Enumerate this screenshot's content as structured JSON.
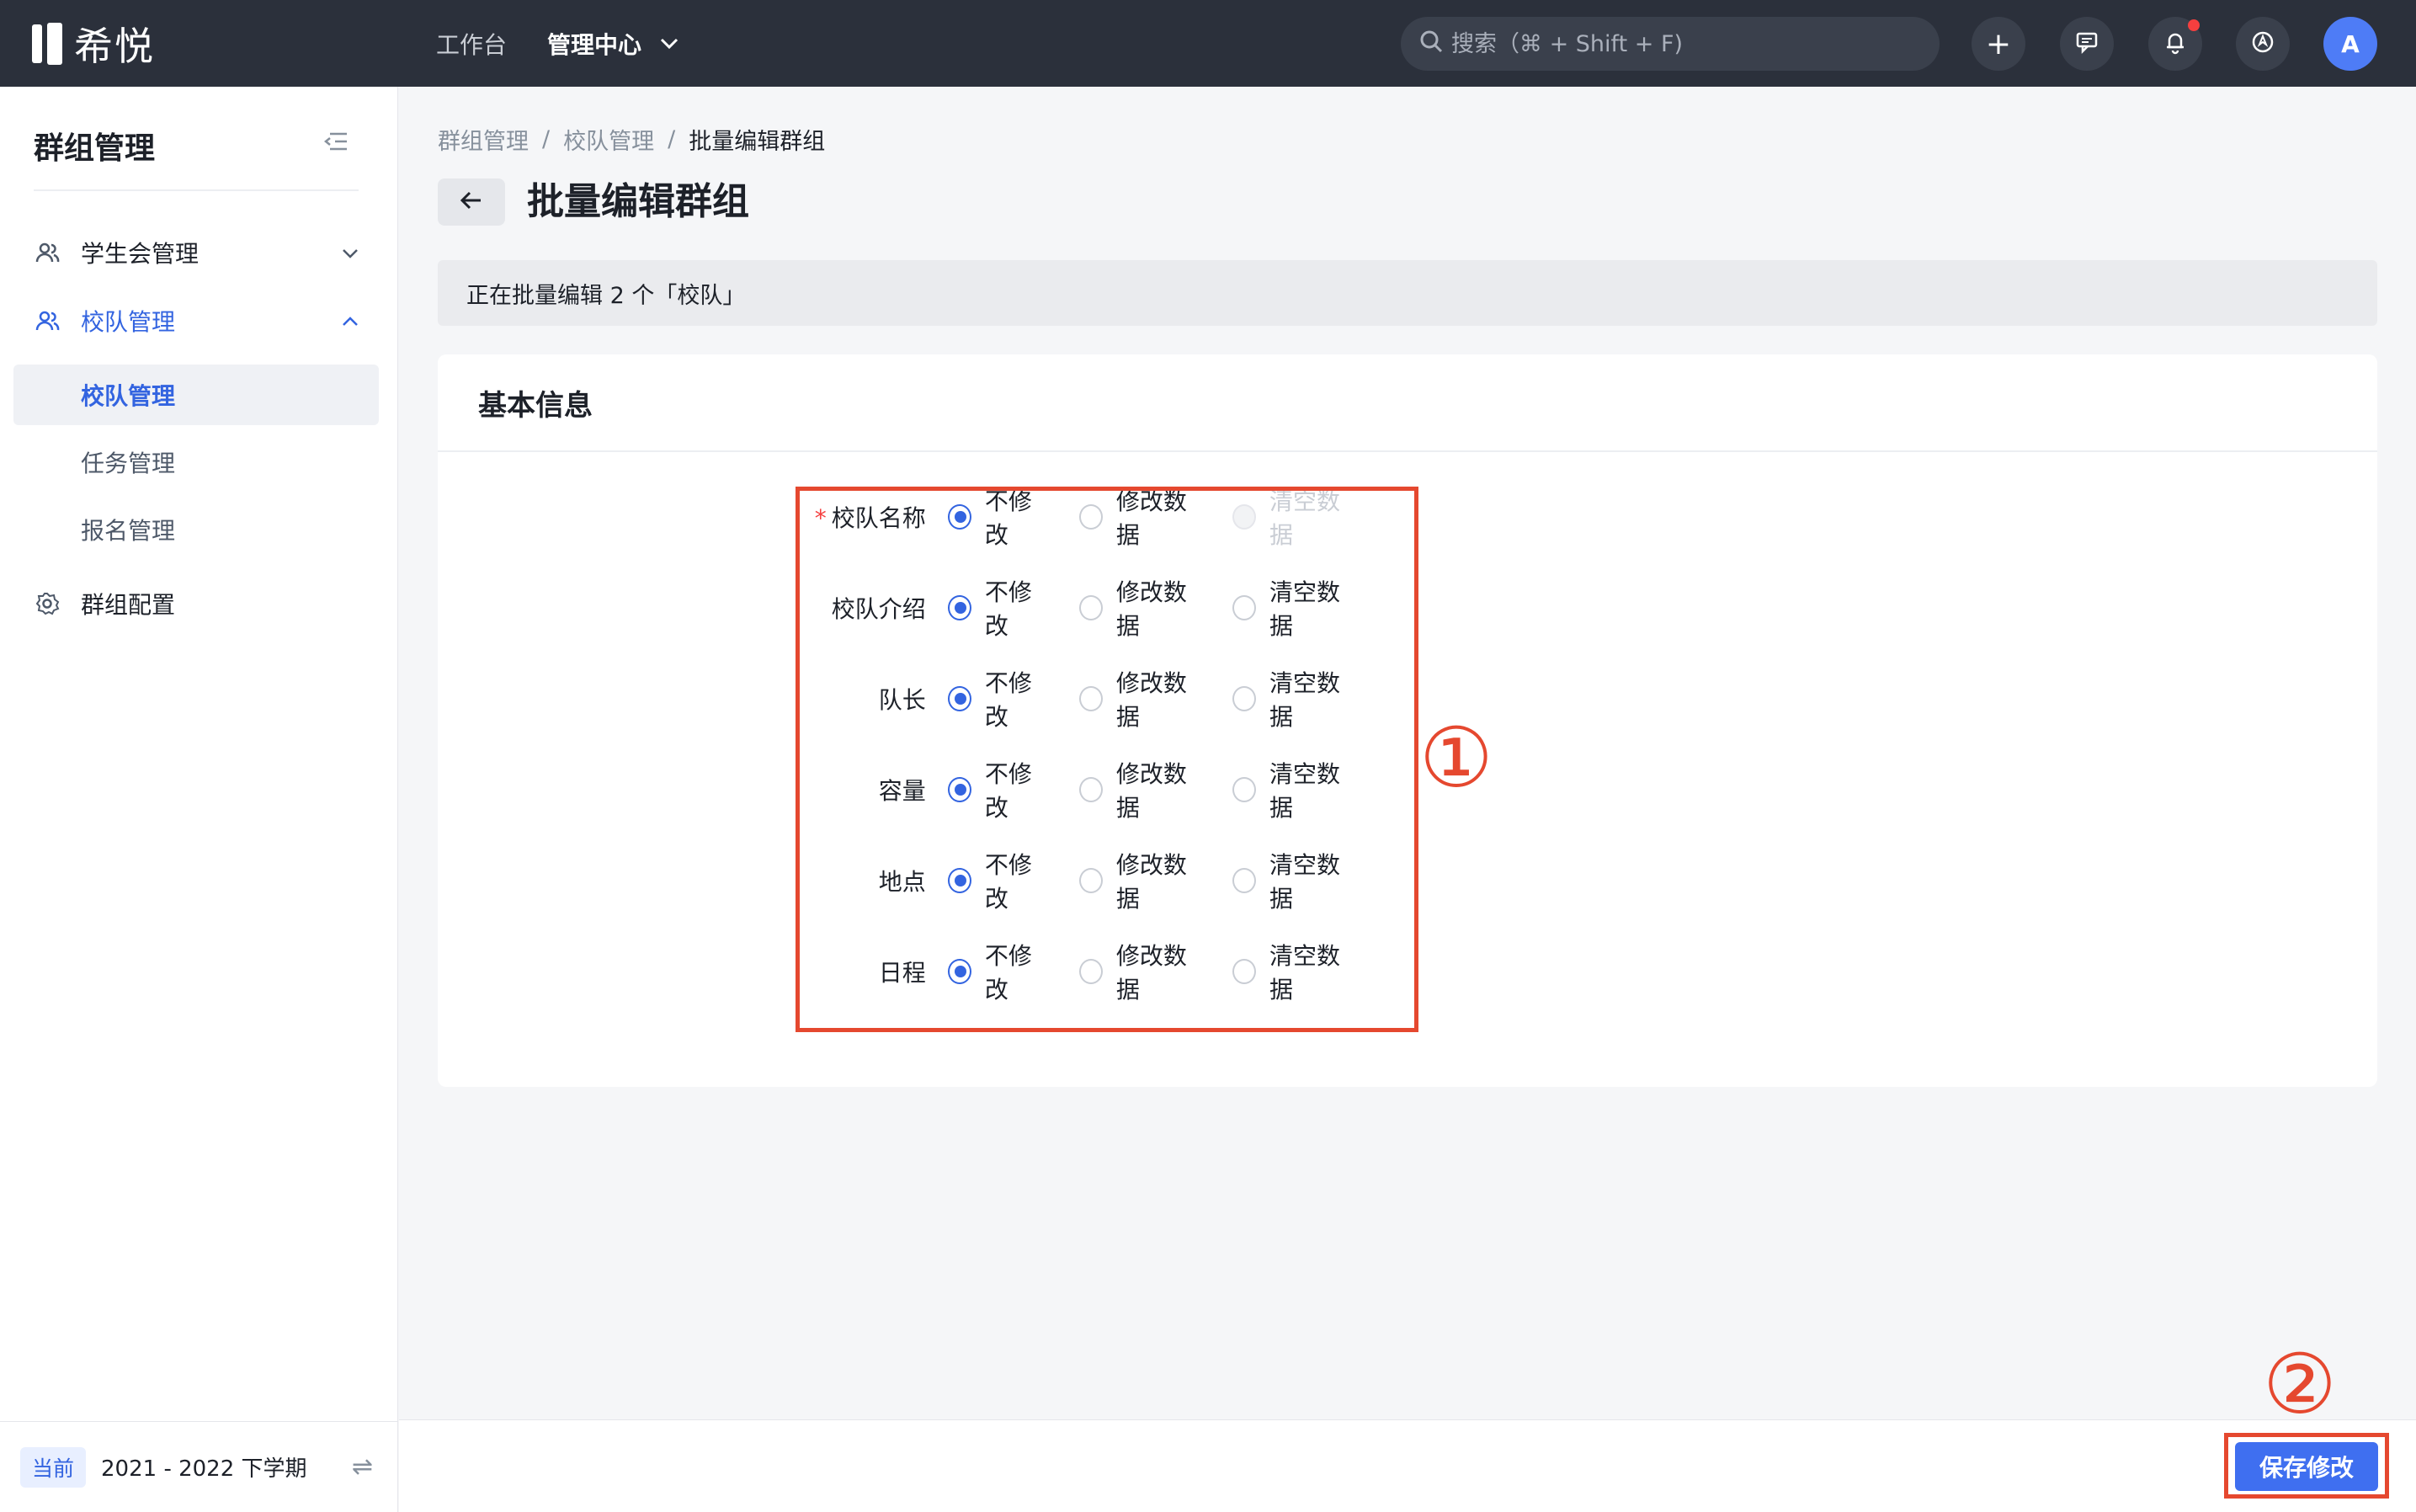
{
  "header": {
    "logo_text": "希悦",
    "nav_workbench": "工作台",
    "nav_admin": "管理中心",
    "search_placeholder": "搜索（⌘ + Shift + F)",
    "plus": "+",
    "avatar_letter": "A"
  },
  "sidebar": {
    "title": "群组管理",
    "items": [
      {
        "label": "学生会管理",
        "arrow": "⌄"
      },
      {
        "label": "校队管理",
        "arrow": "⌃"
      },
      {
        "label": "群组配置"
      }
    ],
    "subitems": [
      "校队管理",
      "任务管理",
      "报名管理"
    ],
    "footer": {
      "tag": "当前",
      "term": "2021 - 2022 下学期",
      "switch": "⇌"
    }
  },
  "breadcrumb": [
    "群组管理",
    "校队管理",
    "批量编辑群组"
  ],
  "breadcrumb_sep": "/",
  "page_title": "批量编辑群组",
  "notice": "正在批量编辑 2 个「校队」",
  "card_title": "基本信息",
  "options": {
    "keep": "不修改",
    "modify": "修改数据",
    "clear": "清空数据"
  },
  "form_rows": [
    {
      "label": "校队名称",
      "required": "*"
    },
    {
      "label": "校队介绍"
    },
    {
      "label": "队长"
    },
    {
      "label": "容量"
    },
    {
      "label": "地点"
    },
    {
      "label": "日程"
    }
  ],
  "annotations": {
    "one": "①",
    "two": "②"
  },
  "save_button": "保存修改",
  "colors": {
    "accent": "#3364e0",
    "annotation": "#e5482f",
    "topbar": "#2b303b"
  }
}
